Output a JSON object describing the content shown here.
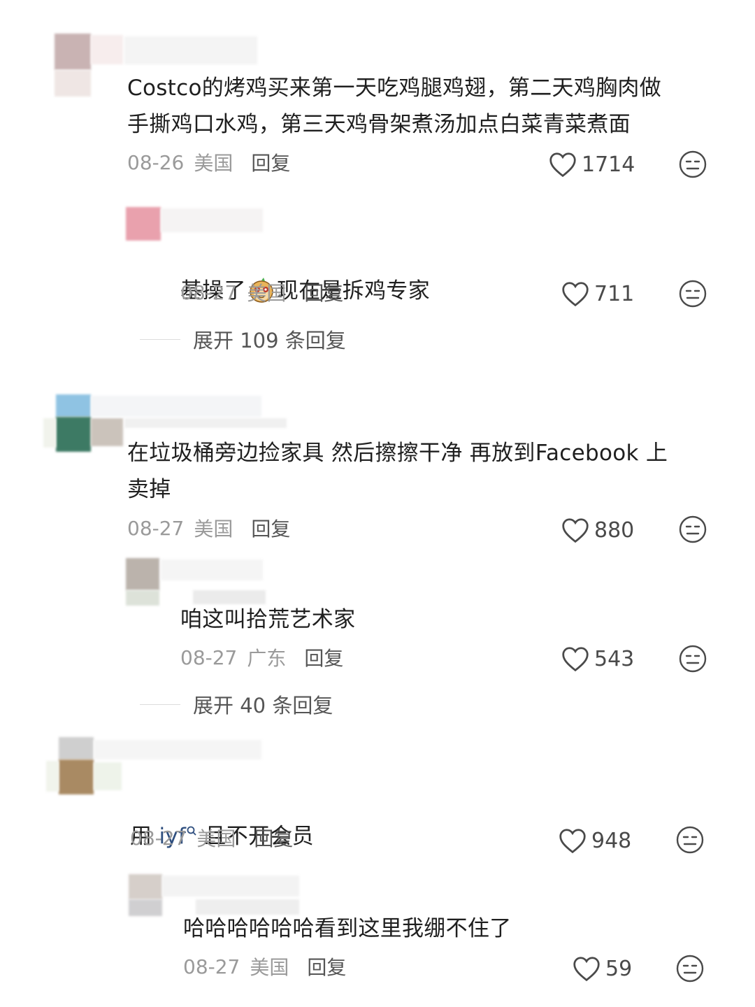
{
  "comments": [
    {
      "text": "Costco的烤鸡买来第一天吃鸡腿鸡翅，第二天鸡胸肉做\n手撕鸡口水鸡，第三天鸡骨架煮汤加点白菜青菜煮面",
      "date": "08-26",
      "location": "美国",
      "reply_label": "回复",
      "likes": "1714",
      "reply": {
        "text_before": "基操了",
        "text_after": "现在是拆鸡专家",
        "date": "08-27",
        "location": "美国",
        "reply_label": "回复",
        "likes": "711"
      },
      "expand_label": "展开 109 条回复"
    },
    {
      "text": "在垃圾桶旁边捡家具 然后擦擦干净 再放到Facebook 上\n卖掉",
      "date": "08-27",
      "location": "美国",
      "reply_label": "回复",
      "likes": "880",
      "reply": {
        "text": "咱这叫拾荒艺术家",
        "date": "08-27",
        "location": "广东",
        "reply_label": "回复",
        "likes": "543"
      },
      "expand_label": "展开 40 条回复"
    },
    {
      "text_before": "用 ",
      "mention": "iyf",
      "text_after": " 且不开会员",
      "date": "08-27",
      "location": "美国",
      "reply_label": "回复",
      "likes": "948",
      "reply": {
        "text": "哈哈哈哈哈哈看到这里我绷不住了",
        "date": "08-27",
        "location": "美国",
        "reply_label": "回复",
        "likes": "59"
      }
    }
  ]
}
